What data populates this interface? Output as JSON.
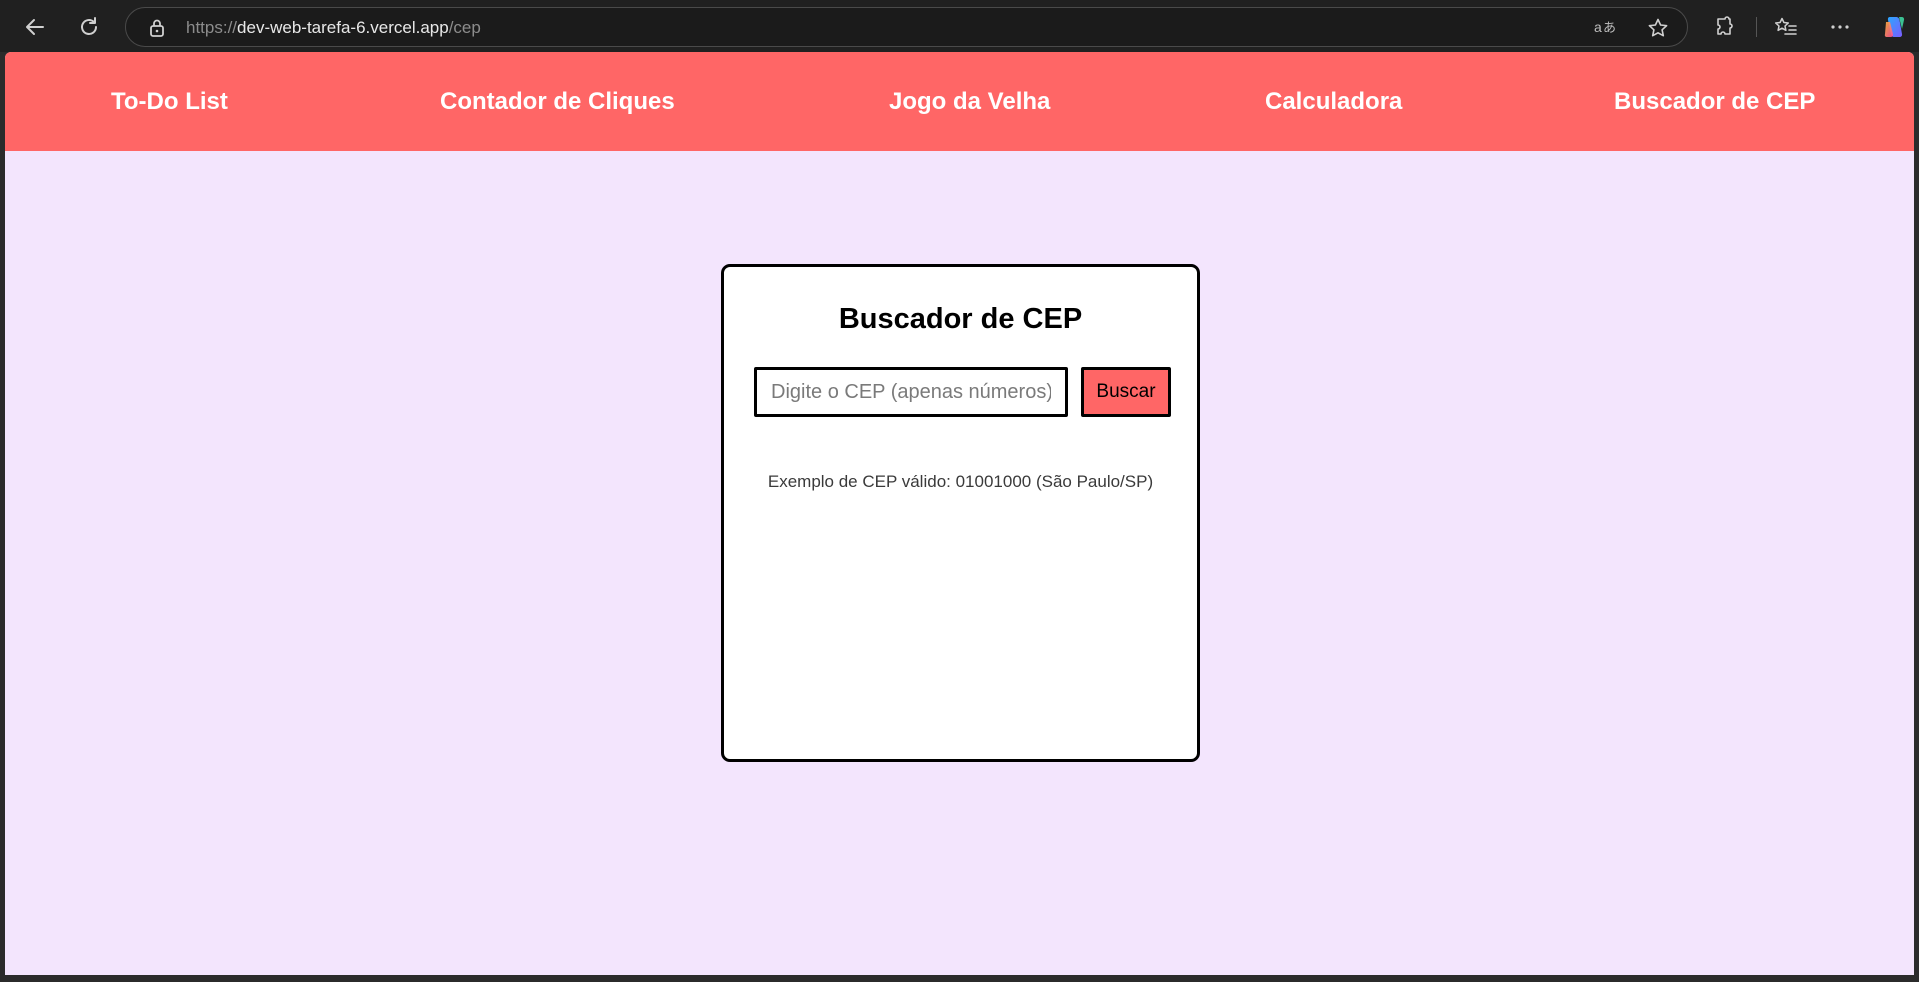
{
  "browser": {
    "url_scheme": "https://",
    "url_host": "dev-web-tarefa-6.vercel.app",
    "url_path": "/cep"
  },
  "nav": {
    "items": [
      {
        "label": "To-Do List"
      },
      {
        "label": "Contador de Cliques"
      },
      {
        "label": "Jogo da Velha"
      },
      {
        "label": "Calculadora"
      },
      {
        "label": "Buscador de CEP"
      }
    ]
  },
  "card": {
    "title": "Buscador de CEP",
    "input_placeholder": "Digite o CEP (apenas números)",
    "input_value": "",
    "button_label": "Buscar",
    "example_text": "Exemplo de CEP válido: 01001000 (São Paulo/SP)"
  },
  "colors": {
    "navbar": "#ff6666",
    "page_background": "#f3e5fd",
    "card_background": "#ffffff",
    "button": "#ff6666"
  },
  "icons": {
    "back": "arrow-left-icon",
    "reload": "refresh-icon",
    "lock": "lock-icon",
    "read_aloud": "read-aloud-icon",
    "favorite": "star-icon",
    "extensions": "puzzle-icon",
    "favorites": "favorites-list-icon",
    "menu": "more-icon",
    "copilot": "copilot-icon"
  }
}
